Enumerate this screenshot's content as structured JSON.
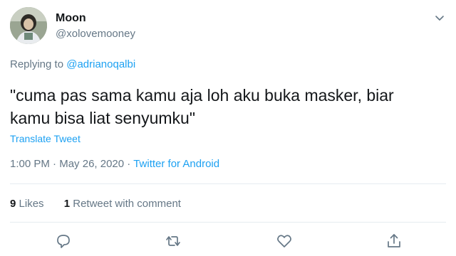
{
  "user": {
    "display_name": "Moon",
    "handle": "@xolovemooney"
  },
  "reply": {
    "prefix": "Replying to",
    "to": "@adrianoqalbi"
  },
  "tweet": {
    "text": "\"cuma pas sama kamu aja loh aku buka masker, biar kamu bisa liat senyumku\"",
    "translate_label": "Translate Tweet",
    "time": "1:00 PM",
    "date": "May 26, 2020",
    "separator": "·",
    "source": "Twitter for Android"
  },
  "stats": {
    "likes_count": "9",
    "likes_label": "Likes",
    "retweets_count": "1",
    "retweets_label": "Retweet with comment"
  },
  "icons": {
    "reply": "reply-icon",
    "retweet": "retweet-icon",
    "like": "heart-icon",
    "share": "share-icon",
    "more": "chevron-down-icon"
  },
  "colors": {
    "accent": "#1da1f2",
    "secondary_text": "#657786",
    "divider": "#e6ecf0"
  }
}
